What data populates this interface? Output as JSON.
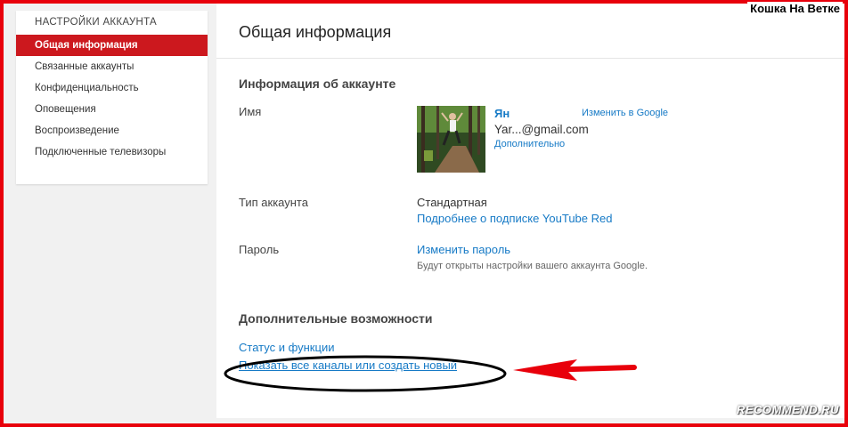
{
  "sidebar": {
    "title": "НАСТРОЙКИ АККАУНТА",
    "items": [
      {
        "label": "Общая информация",
        "active": true
      },
      {
        "label": "Связанные аккаунты"
      },
      {
        "label": "Конфиденциальность"
      },
      {
        "label": "Оповещения"
      },
      {
        "label": "Воспроизведение"
      },
      {
        "label": "Подключенные телевизоры"
      }
    ]
  },
  "main": {
    "title": "Общая информация",
    "account_info": {
      "heading": "Информация об аккаунте",
      "name_label": "Имя",
      "name_value": "Ян",
      "change_in_google": "Изменить в Google",
      "email": "Yar...@gmail.com",
      "more": "Дополнительно",
      "type_label": "Тип аккаунта",
      "type_value": "Стандартная",
      "youtube_red_link": "Подробнее о подписке YouTube Red",
      "password_label": "Пароль",
      "change_password": "Изменить пароль",
      "password_note": "Будут открыты настройки вашего аккаунта Google."
    },
    "extra": {
      "heading": "Дополнительные возможности",
      "status_link": "Статус и функции",
      "channels_link": "Показать все каналы или создать новый"
    }
  },
  "watermarks": {
    "top": "Кошка На Ветке",
    "bottom": "RECOMMEND.RU"
  },
  "colors": {
    "accent_red": "#cc181e",
    "link_blue": "#167ac6",
    "frame_red": "#e8000b"
  }
}
